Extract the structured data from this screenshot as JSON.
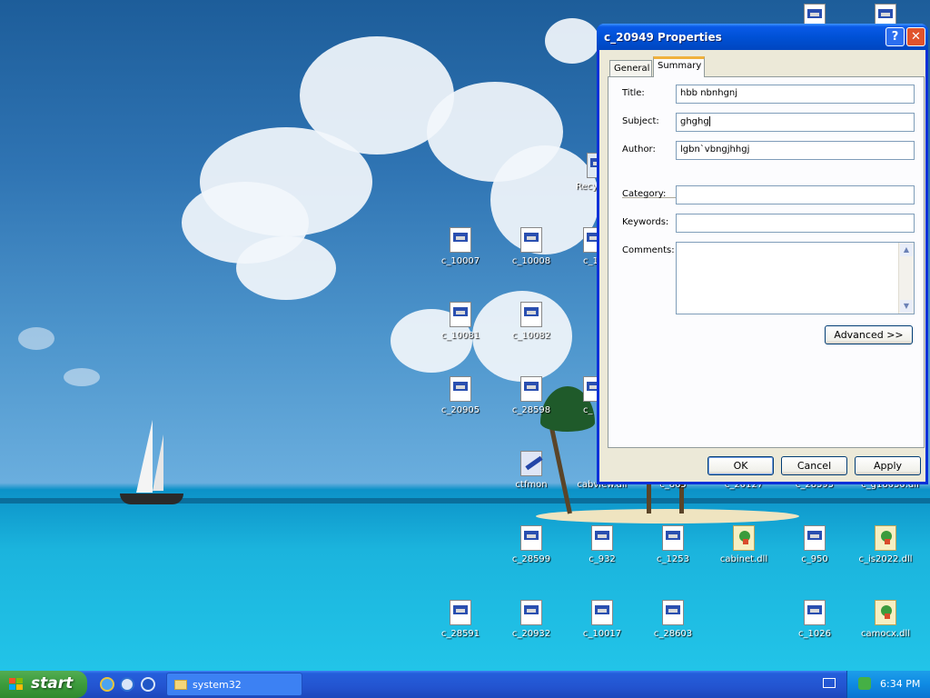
{
  "dialog": {
    "title": "c_20949 Properties",
    "help_glyph": "?",
    "close_glyph": "✕",
    "tabs": [
      "General",
      "Summary"
    ],
    "active_tab": "Summary",
    "fields": {
      "title_label": "Title:",
      "title_value": "hbb nbnhgnj",
      "subject_label": "Subject:",
      "subject_value": "ghghg",
      "author_label": "Author:",
      "author_value": "lgbn`vbngjhhgj",
      "category_label": "Category:",
      "category_value": "",
      "keywords_label": "Keywords:",
      "keywords_value": "",
      "comments_label": "Comments:",
      "comments_value": ""
    },
    "advanced_label": "Advanced >>",
    "ok_label": "OK",
    "cancel_label": "Cancel",
    "apply_label": "Apply"
  },
  "desktop": {
    "icons": [
      {
        "label": "c_10007",
        "kind": "dll-icon"
      },
      {
        "label": "c_10008",
        "kind": "dll-icon"
      },
      {
        "label": "c_1",
        "kind": "dll-icon"
      },
      {
        "label": "c_10081",
        "kind": "dll-icon"
      },
      {
        "label": "c_10082",
        "kind": "dll-icon"
      },
      {
        "label": "c_20905",
        "kind": "dll-icon"
      },
      {
        "label": "c_28598",
        "kind": "dll-icon"
      },
      {
        "label": "c_",
        "kind": "dll-icon"
      },
      {
        "label": "ctfmon",
        "kind": "ctfmon-icon"
      },
      {
        "label": "cabview.dll",
        "kind": "dll-icon"
      },
      {
        "label": "c_865",
        "kind": "dll-icon"
      },
      {
        "label": "c_20127",
        "kind": "dll-icon"
      },
      {
        "label": "c_28595",
        "kind": "dll-icon"
      },
      {
        "label": "c_g18030.dll",
        "kind": "dll-icon"
      },
      {
        "label": "c_28599",
        "kind": "dll-icon"
      },
      {
        "label": "c_932",
        "kind": "dll-icon"
      },
      {
        "label": "c_1253",
        "kind": "dll-icon"
      },
      {
        "label": "cabinet.dll",
        "kind": "setup-icon"
      },
      {
        "label": "c_950",
        "kind": "dll-icon"
      },
      {
        "label": "c_is2022.dll",
        "kind": "setup-icon"
      },
      {
        "label": "c_28591",
        "kind": "dll-icon"
      },
      {
        "label": "c_20932",
        "kind": "dll-icon"
      },
      {
        "label": "c_10017",
        "kind": "dll-icon"
      },
      {
        "label": "c_28603",
        "kind": "dll-icon"
      },
      {
        "label": "c_1026",
        "kind": "dll-icon"
      },
      {
        "label": "camocx.dll",
        "kind": "setup-icon"
      },
      {
        "label": "Recy",
        "kind": "recycle-bin-icon"
      }
    ]
  },
  "taskbar": {
    "start_label": "start",
    "task_label": "system32",
    "clock": "6:34 PM"
  },
  "colors": {
    "titlebar": "#0054e3",
    "start_green": "#3c9b3c",
    "taskbar_blue": "#245edb"
  }
}
